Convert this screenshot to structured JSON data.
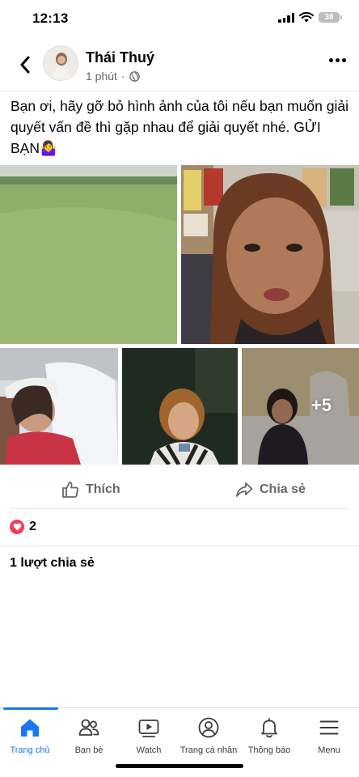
{
  "status_bar": {
    "time": "12:13",
    "battery": "38"
  },
  "post": {
    "author": "Thái Thuý",
    "time": "1 phút",
    "text": "Bạn ơi, hãy gỡ bỏ hình ảnh của tôi nếu bạn muốn giải quyết vấn đề thì gặp nhau để giải quyết nhé. GỬI BẠN🤷‍♀️",
    "more_photos": "+5"
  },
  "actions": {
    "like": "Thích",
    "share": "Chia sẻ"
  },
  "reactions": {
    "count": "2"
  },
  "shares": {
    "label": "1 lượt chia sẻ"
  },
  "tabs": [
    {
      "label": "Trang chủ",
      "icon": "home-icon"
    },
    {
      "label": "Bạn bè",
      "icon": "friends-icon"
    },
    {
      "label": "Watch",
      "icon": "watch-icon"
    },
    {
      "label": "Trang cá nhân",
      "icon": "profile-icon"
    },
    {
      "label": "Thông báo",
      "icon": "bell-icon"
    },
    {
      "label": "Menu",
      "icon": "menu-icon"
    }
  ],
  "colors": {
    "accent": "#1877f2",
    "secondary_text": "#65676b",
    "heart": "#f33e58"
  }
}
